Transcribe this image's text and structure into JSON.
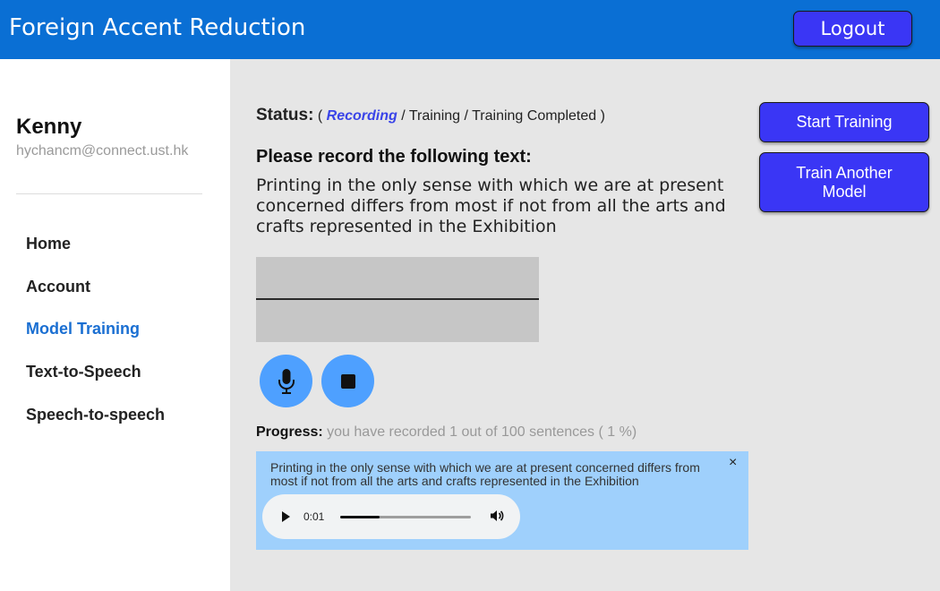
{
  "header": {
    "app_title": "Foreign Accent Reduction",
    "logout_label": "Logout"
  },
  "sidebar": {
    "user_name": "Kenny",
    "user_email": "hychancm@connect.ust.hk",
    "items": [
      {
        "label": "Home",
        "active": false
      },
      {
        "label": "Account",
        "active": false
      },
      {
        "label": "Model Training",
        "active": true
      },
      {
        "label": "Text-to-Speech",
        "active": false
      },
      {
        "label": "Speech-to-speech",
        "active": false
      }
    ]
  },
  "main": {
    "status": {
      "label": "Status:",
      "open": "(",
      "current": "Recording",
      "sep1": "/",
      "step2": "Training",
      "sep2": "/",
      "step3": "Training Completed",
      "close": ")"
    },
    "prompt_title": "Please record the following text:",
    "sentence": "Printing in the only sense with which we are at present concerned differs from most if not from all the arts and crafts represented in the Exhibition",
    "controls": {
      "record_icon": "microphone-icon",
      "stop_icon": "stop-icon"
    },
    "progress": {
      "label": "Progress:",
      "text": "you have recorded 1 out of 100 sentences ( 1 %)",
      "recorded": 1,
      "total": 100
    },
    "recording_card": {
      "text": "Printing in the only sense with which we are at present concerned differs from most if not from all the arts and crafts represented in the Exhibition",
      "close_symbol": "×",
      "player": {
        "time": "0:01",
        "position_fraction": 0.3
      }
    }
  },
  "actions": {
    "start_training_label": "Start Training",
    "train_another_label": "Train Another Model"
  },
  "colors": {
    "header_bg": "#0a6fd4",
    "button_bg": "#3a36f5",
    "active_nav": "#1a6fd2",
    "round_button": "#4ea0ff",
    "card_bg": "#9fd0fc"
  }
}
